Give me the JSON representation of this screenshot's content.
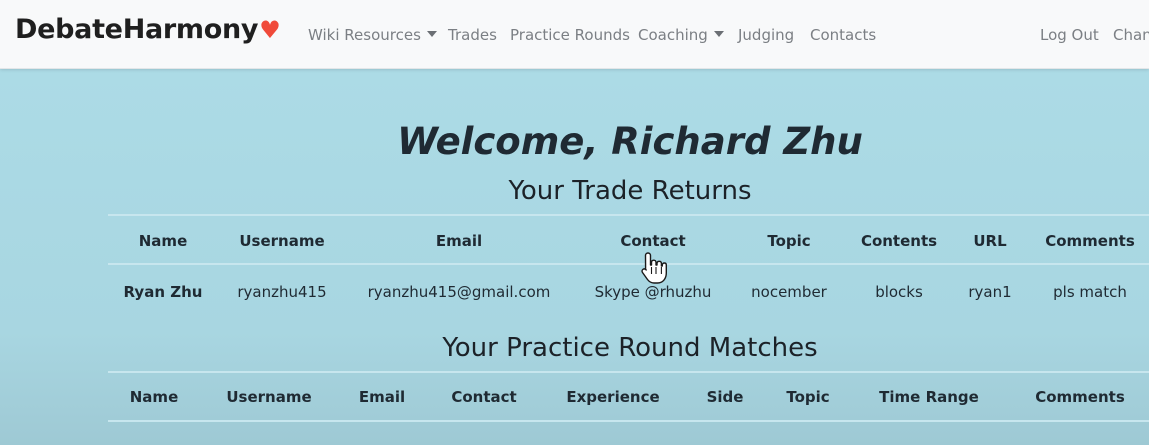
{
  "navbar": {
    "brand": "DebateHarmony",
    "brand_heart": "♥",
    "items": [
      {
        "label": "Wiki Resources",
        "dropdown": true
      },
      {
        "label": "Trades",
        "dropdown": false
      },
      {
        "label": "Practice Rounds",
        "dropdown": false
      },
      {
        "label": "Coaching",
        "dropdown": true
      },
      {
        "label": "Judging",
        "dropdown": false
      },
      {
        "label": "Contacts",
        "dropdown": false
      }
    ],
    "right_items": [
      {
        "label": "Log Out"
      },
      {
        "label": "Chan"
      }
    ]
  },
  "main": {
    "welcome": "Welcome, Richard Zhu",
    "trade_returns": {
      "title": "Your Trade Returns",
      "headers": [
        "Name",
        "Username",
        "Email",
        "Contact",
        "Topic",
        "Contents",
        "URL",
        "Comments"
      ],
      "rows": [
        [
          "Ryan Zhu",
          "ryanzhu415",
          "ryanzhu415@gmail.com",
          "Skype @rhuzhu",
          "nocember",
          "blocks",
          "ryan1",
          "pls match"
        ]
      ]
    },
    "practice_matches": {
      "title": "Your Practice Round Matches",
      "headers": [
        "Name",
        "Username",
        "Email",
        "Contact",
        "Experience",
        "Side",
        "Topic",
        "Time Range",
        "Comments"
      ]
    }
  },
  "colors": {
    "page_background": "#a9d8e3",
    "navbar_background": "#f8f9fa",
    "brand_heart": "#f04a3a",
    "nav_text": "#7b7f84",
    "heading_text": "#1f2a33"
  }
}
